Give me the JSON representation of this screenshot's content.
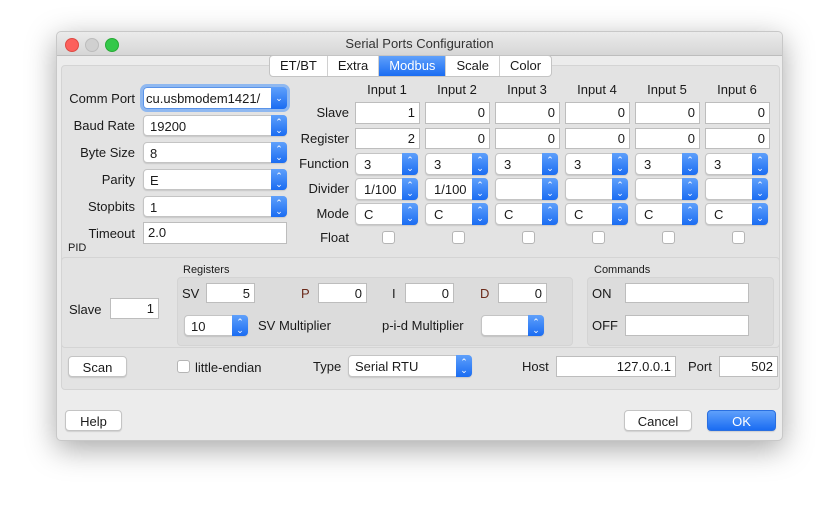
{
  "window": {
    "title": "Serial Ports Configuration"
  },
  "tabs": [
    {
      "label": "ET/BT"
    },
    {
      "label": "Extra"
    },
    {
      "label": "Modbus",
      "selected": true
    },
    {
      "label": "Scale"
    },
    {
      "label": "Color"
    }
  ],
  "serial": {
    "comm_port_label": "Comm Port",
    "comm_port": "/cu.usbmodem1421",
    "baud_rate_label": "Baud Rate",
    "baud_rate": "19200",
    "byte_size_label": "Byte Size",
    "byte_size": "8",
    "parity_label": "Parity",
    "parity": "E",
    "stopbits_label": "Stopbits",
    "stopbits": "1",
    "timeout_label": "Timeout",
    "timeout": "2.0"
  },
  "inputs": {
    "row_labels": {
      "slave": "Slave",
      "register": "Register",
      "function": "Function",
      "divider": "Divider",
      "mode": "Mode",
      "float": "Float"
    },
    "columns": [
      {
        "header": "Input 1",
        "slave": "1",
        "register": "2",
        "function": "3",
        "divider": "1/100",
        "mode": "C",
        "float": false
      },
      {
        "header": "Input 2",
        "slave": "0",
        "register": "0",
        "function": "3",
        "divider": "1/100",
        "mode": "C",
        "float": false
      },
      {
        "header": "Input 3",
        "slave": "0",
        "register": "0",
        "function": "3",
        "divider": "",
        "mode": "C",
        "float": false
      },
      {
        "header": "Input 4",
        "slave": "0",
        "register": "0",
        "function": "3",
        "divider": "",
        "mode": "C",
        "float": false
      },
      {
        "header": "Input 5",
        "slave": "0",
        "register": "0",
        "function": "3",
        "divider": "",
        "mode": "C",
        "float": false
      },
      {
        "header": "Input 6",
        "slave": "0",
        "register": "0",
        "function": "3",
        "divider": "",
        "mode": "C",
        "float": false
      }
    ]
  },
  "pid": {
    "label": "PID",
    "slave_label": "Slave",
    "slave": "1",
    "registers_label": "Registers",
    "sv_label": "SV",
    "sv": "5",
    "p_label": "P",
    "p": "0",
    "i_label": "I",
    "i": "0",
    "d_label": "D",
    "d": "0",
    "sv_multiplier": "10",
    "sv_multiplier_label": "SV Multiplier",
    "pid_multiplier_label": "p-i-d Multiplier",
    "pid_multiplier": "",
    "commands_label": "Commands",
    "on_label": "ON",
    "on": "",
    "off_label": "OFF",
    "off": ""
  },
  "bottom": {
    "scan_label": "Scan",
    "little_endian_label": "little-endian",
    "little_endian": false,
    "type_label": "Type",
    "type": "Serial RTU",
    "host_label": "Host",
    "host": "127.0.0.1",
    "port_label": "Port",
    "port": "502"
  },
  "buttons": {
    "help": "Help",
    "cancel": "Cancel",
    "ok": "OK"
  },
  "colors": {
    "accent": "#1a6cf2",
    "close": "#fc605c",
    "minimize": "#d0d0d0",
    "zoom": "#34c84a"
  }
}
